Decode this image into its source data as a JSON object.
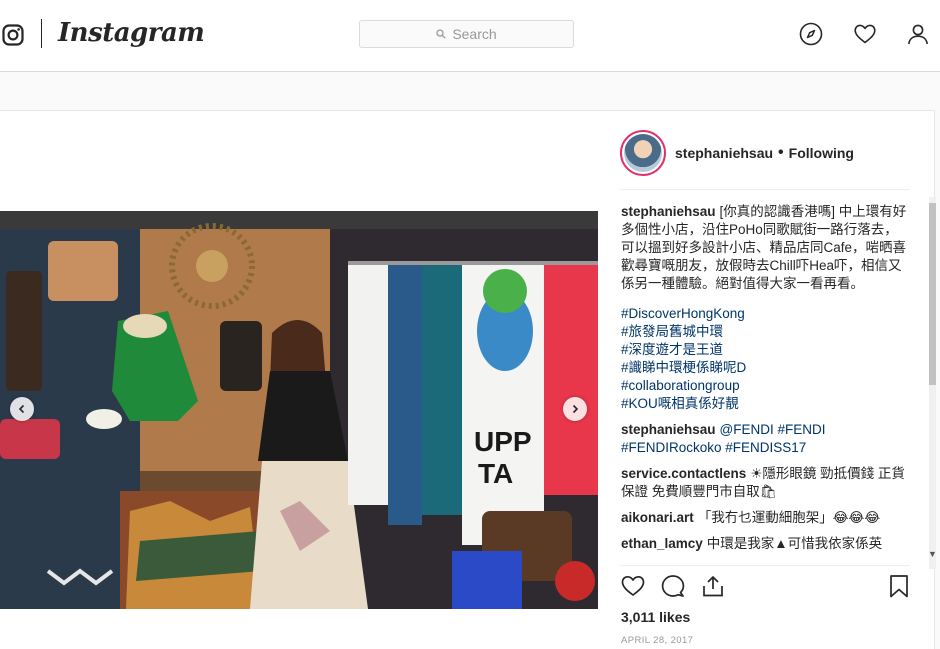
{
  "nav": {
    "wordmark": "Instagram",
    "search_placeholder": "Search"
  },
  "post": {
    "username": "stephaniehsau",
    "separator": "•",
    "follow_status": "Following",
    "caption_user": "stephaniehsau",
    "caption": "[你真的認識香港嗎] 中上環有好多個性小店，沿住PoHo同歌賦街一路行落去，可以搵到好多設計小店、精品店同Cafe，啱晒喜歡尋寶嘅朋友，放假時去Chill吓Hea吓，相信又係另一種體驗。絕對值得大家一看再看。",
    "hashtags": [
      "#DiscoverHongKong",
      "#旅發局舊城中環",
      "#深度遊才是王道",
      "#識睇中環梗係睇呢D",
      "#collaborationgroup",
      "#KOU嘅相真係好靚"
    ],
    "comments": [
      {
        "user": "stephaniehsau",
        "text": "@FENDI #FENDI #FENDIRockoko #FENDISS17"
      },
      {
        "user": "service.contactlens",
        "text": "☀隱形眼鏡 勁抵價錢 正貨保證 免費順豐門市自取🛍"
      },
      {
        "user": "aikonari.art",
        "text": "「我冇乜運動細胞架」😂😂😂"
      },
      {
        "user": "ethan_lamcy",
        "text": "中環是我家▲可惜我依家係英"
      }
    ],
    "likes": "3,011 likes",
    "date": "APRIL 28, 2017"
  },
  "icons": {
    "instagram_glyph": "instagram-glyph-icon",
    "search": "search-icon",
    "explore": "compass-icon",
    "activity": "heart-icon",
    "profile": "user-icon",
    "like": "heart-outline-icon",
    "comment": "comment-icon",
    "share": "share-icon",
    "save": "bookmark-icon",
    "prev": "chevron-left-icon",
    "next": "chevron-right-icon"
  }
}
